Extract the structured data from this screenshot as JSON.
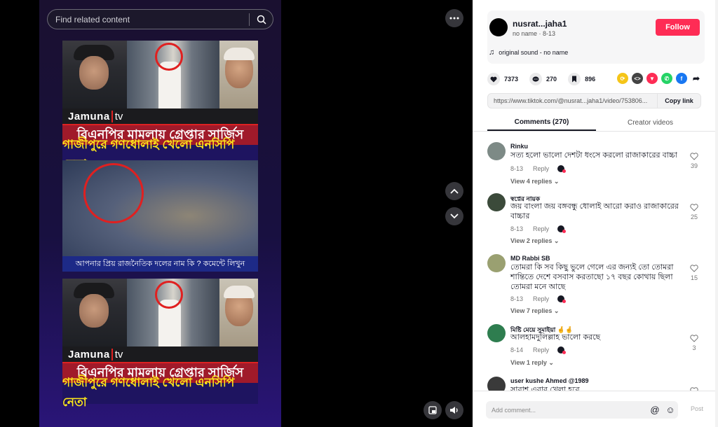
{
  "search": {
    "placeholder": "Find related content"
  },
  "video": {
    "logo": "Jamuna",
    "logo_tv": "tv",
    "headline_top": "বিএনপির মামলায় গ্রেপ্তার সার্জিস",
    "headline_bottom": "গাজীপুরে গণধোলাই খেলো এনসিপি নেতা",
    "mid_caption": "আপনার প্রিয় রাজনৈতিক দলের নাম কি ? কমেন্টে লিখুন"
  },
  "author": {
    "name": "nusrat...jaha1",
    "meta": "no name · 8-13",
    "follow_label": "Follow",
    "sound": "original sound - no name"
  },
  "stats": {
    "likes": "7373",
    "comments": "270",
    "saves": "896"
  },
  "share_link": {
    "url": "https://www.tiktok.com/@nusrat...jaha1/video/753806...",
    "copy_label": "Copy link"
  },
  "tabs": {
    "comments": "Comments (270)",
    "creator": "Creator videos"
  },
  "comments": [
    {
      "user": "Rinku",
      "text": "সত্য হলো ভালো দেশটা ধংসে করলো রাজাকারের বাচ্চা",
      "date": "8-13",
      "reply": "Reply",
      "likes": "39",
      "view_replies": "View 4 replies"
    },
    {
      "user": "স্বপ্নের নায়ক",
      "text": "জয় বাংলা জয় বঙ্গবন্ধু ধোলাই আরো করাও রাজাকারের বাচ্চার",
      "date": "8-13",
      "reply": "Reply",
      "likes": "25",
      "view_replies": "View 2 replies"
    },
    {
      "user": "MD Rabbi SB",
      "text": "তোমরা কি সব কিছু ভুলে গেলে এর জন্যই তো তোমরা শান্তিতে দেশে বসবাস করতাছো ১৭ বছর কোথায় ছিলা তোমরা মনে আছে",
      "date": "8-13",
      "reply": "Reply",
      "likes": "15",
      "view_replies": "View 7 replies"
    },
    {
      "user": "মিষ্টি মেয়ে সুমাইয়া 🤞🤞",
      "text": "আলহামদুলিল্লাহ ভালো করছে",
      "date": "8-14",
      "reply": "Reply",
      "likes": "3",
      "view_replies": "View 1 reply"
    },
    {
      "user": "user kushe Ahmed @1989",
      "text": "সাবাশ এবার খেলা হবে",
      "date": "",
      "reply": "",
      "likes": "",
      "view_replies": ""
    }
  ],
  "comment_input": {
    "placeholder": "Add comment...",
    "post_label": "Post"
  },
  "colors": {
    "accent": "#fe2c55",
    "headline_red": "#a01a2a",
    "headline_yellow": "#ffe81a"
  }
}
